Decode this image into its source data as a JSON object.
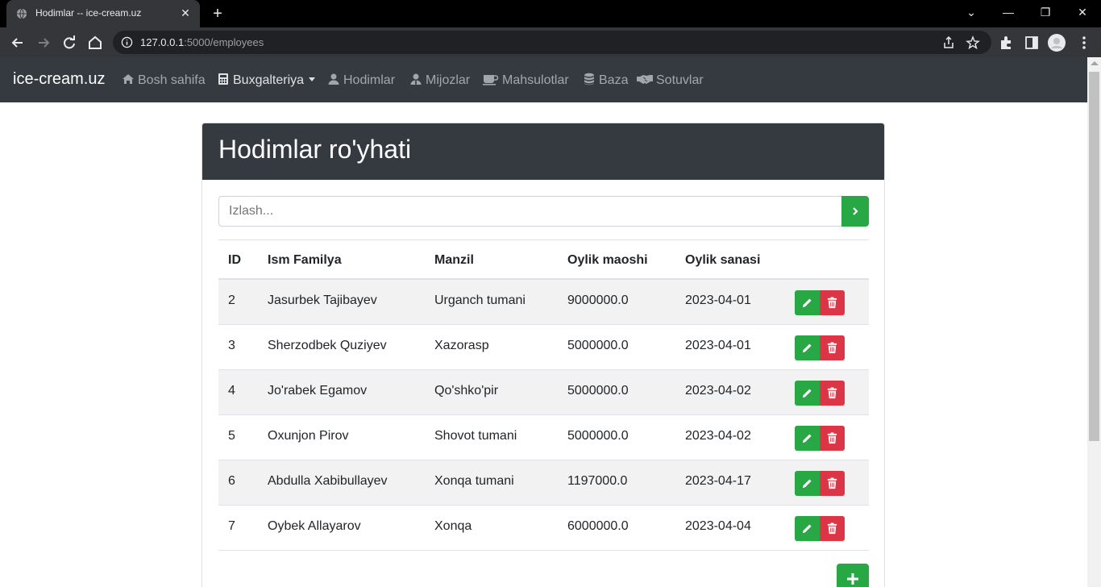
{
  "browser": {
    "tab_title": "Hodimlar -- ice-cream.uz",
    "tab_close": "✕",
    "new_tab": "+",
    "url_host": "127.0.0.1",
    "url_path": ":5000/employees",
    "window_minimize": "—",
    "window_restore": "❐",
    "window_close": "✕",
    "tab_dropdown": "⌄"
  },
  "navbar": {
    "brand": "ice-cream.uz",
    "items": [
      {
        "label": "Bosh sahifa",
        "icon": "home-icon"
      },
      {
        "label": "Buxgalteriya",
        "icon": "calculator-icon",
        "dropdown": true
      },
      {
        "label": "Hodimlar",
        "icon": "user-icon"
      },
      {
        "label": "Mijozlar",
        "icon": "user-tie-icon"
      },
      {
        "label": "Mahsulotlar",
        "icon": "coffee-icon"
      },
      {
        "label": "Baza",
        "icon": "database-icon"
      },
      {
        "label": "Sotuvlar",
        "icon": "handshake-icon"
      }
    ]
  },
  "main": {
    "title": "Hodimlar ro'yhati",
    "search_placeholder": "Izlash...",
    "table": {
      "headers": [
        "ID",
        "Ism Familya",
        "Manzil",
        "Oylik maoshi",
        "Oylik sanasi"
      ],
      "rows": [
        [
          "2",
          "Jasurbek Tajibayev",
          "Urganch tumani",
          "9000000.0",
          "2023-04-01"
        ],
        [
          "3",
          "Sherzodbek Quziyev",
          "Xazorasp",
          "5000000.0",
          "2023-04-01"
        ],
        [
          "4",
          "Jo'rabek Egamov",
          "Qo'shko'pir",
          "5000000.0",
          "2023-04-02"
        ],
        [
          "5",
          "Oxunjon Pirov",
          "Shovot tumani",
          "5000000.0",
          "2023-04-02"
        ],
        [
          "6",
          "Abdulla Xabibullayev",
          "Xonqa tumani",
          "1197000.0",
          "2023-04-17"
        ],
        [
          "7",
          "Oybek Allayarov",
          "Xonqa",
          "6000000.0",
          "2023-04-04"
        ]
      ]
    }
  },
  "colors": {
    "navbar_bg": "#343a40",
    "success": "#28a745",
    "danger": "#dc3545",
    "stripe": "#f2f2f2"
  }
}
